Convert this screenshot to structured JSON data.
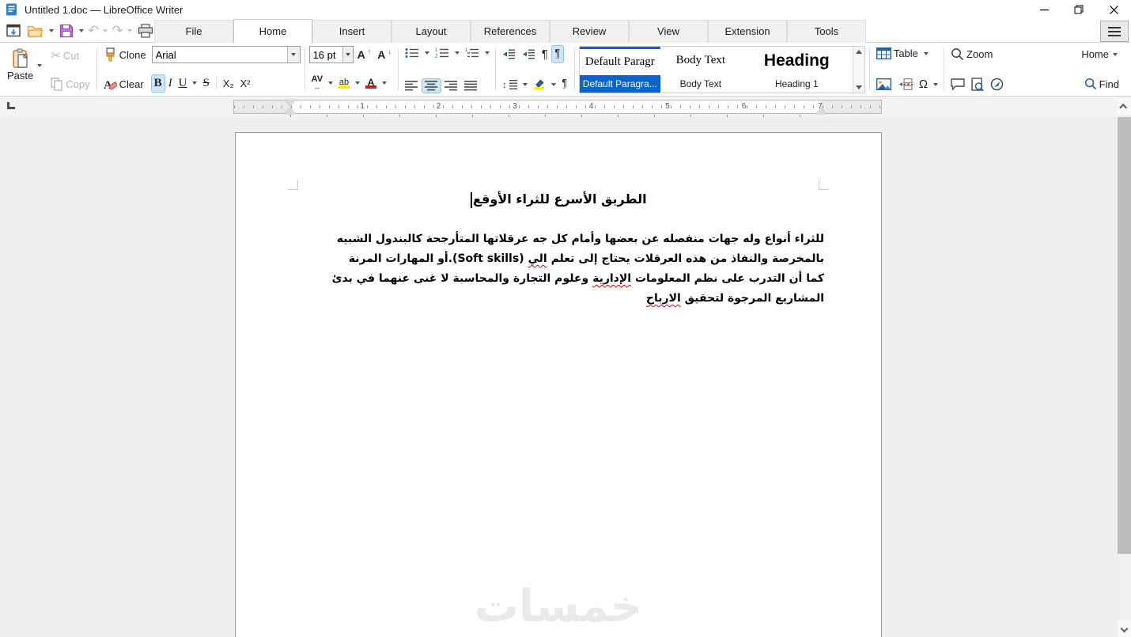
{
  "window": {
    "title": "Untitled 1.doc — LibreOffice Writer"
  },
  "tabs": {
    "items": [
      "File",
      "Home",
      "Insert",
      "Layout",
      "References",
      "Review",
      "View",
      "Extension",
      "Tools"
    ],
    "active": "Home"
  },
  "toolbar": {
    "paste_label": "Paste",
    "cut_label": "Cut",
    "copy_label": "Copy",
    "clone_label": "Clone",
    "clear_label": "Clear",
    "font_name": "Arial",
    "font_size": "16 pt",
    "bold_label": "B",
    "italic_label": "I",
    "underline_label": "U",
    "strikethrough_label": "S",
    "subscript_label": "X₂",
    "superscript_label": "X²",
    "grow_font_label": "A",
    "shrink_font_label": "A",
    "char_spacing_label": "AV",
    "highlight_label": "ab",
    "font_color_label": "A",
    "table_label": "Table",
    "zoom_label": "Zoom",
    "home_menu_label": "Home",
    "find_label": "Find"
  },
  "icons": {
    "scissors": "✂",
    "undo": "↶",
    "redo": "↷",
    "omega": "Ω",
    "pilcrow": "¶",
    "arrow_up": "↑",
    "arrow_down": "↓",
    "arrow_lr": "↔",
    "arrow_ud": "↕"
  },
  "styles": {
    "items": [
      {
        "preview": "Default Paragr",
        "name": "Default Paragra...",
        "selected": true
      },
      {
        "preview": "Body Text",
        "name": "Body Text",
        "selected": false
      },
      {
        "preview": "Heading",
        "name": "Heading 1",
        "selected": false
      }
    ]
  },
  "ruler": {
    "numbers": [
      "1",
      "2",
      "3",
      "4",
      "5",
      "6",
      "7"
    ]
  },
  "document": {
    "title": "الطريق الأسرع للثراء الأوقع",
    "lines": [
      {
        "segments": [
          {
            "text": "للثراء أنواع وله جهات منفصله عن بعضها وأمام كل جه عرقلاتها المتأرجحة كالبندول الشبيه"
          }
        ]
      },
      {
        "segments": [
          {
            "text": "بالمخرصة والنفاذ من هذه العرقلات يحتاج إلى تعلم "
          },
          {
            "text": "الي",
            "misspelled": true
          },
          {
            "text": " (Soft skills).أو المهارات المرنة"
          }
        ]
      },
      {
        "segments": [
          {
            "text": "كما أن التدرب على نظم المعلومات "
          },
          {
            "text": "الإدارية",
            "misspelled": true
          },
          {
            "text": " وعلوم التجارة والمحاسبة لا غنى عنهما في بدئ"
          }
        ]
      },
      {
        "segments": [
          {
            "text": "المشاريع المرجوة لتحقيق "
          },
          {
            "text": "الارباح",
            "misspelled": true
          }
        ]
      }
    ],
    "watermark": "خمسات"
  },
  "colors": {
    "accent_blue": "#0b63ce",
    "toggle_highlight": "#cde6f7",
    "spellcheck_red": "#e30000",
    "watermark_gray": "#eaeaea"
  }
}
